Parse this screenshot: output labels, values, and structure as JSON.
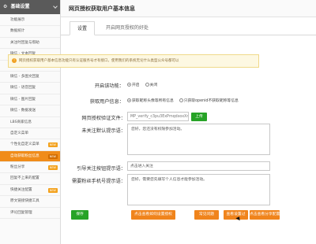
{
  "sidebar": {
    "header": "基础设置",
    "items": [
      {
        "label": "功能展示",
        "badge": ""
      },
      {
        "label": "数据统计",
        "badge": ""
      },
      {
        "label": "关注时回复与帮助",
        "badge": ""
      },
      {
        "label": "微信 - 文本回复",
        "badge": ""
      },
      {
        "label": "微信 - 图文回复",
        "badge": ""
      },
      {
        "label": "微信 - 多图文回复",
        "badge": ""
      },
      {
        "label": "微信 - 语音回复",
        "badge": ""
      },
      {
        "label": "微信 - 图片回复",
        "badge": ""
      },
      {
        "label": "微信 - 数据发送",
        "badge": ""
      },
      {
        "label": "LBS商家信息",
        "badge": ""
      },
      {
        "label": "自定义菜单",
        "badge": ""
      },
      {
        "label": "个性化自定义菜单",
        "badge": "NEW"
      },
      {
        "label": "自动获取粉丝信息",
        "badge": "NEW"
      },
      {
        "label": "粉丝分享",
        "badge": "NEW"
      },
      {
        "label": "回复不上来的配置",
        "badge": ""
      },
      {
        "label": "快捷关注配置",
        "badge": "NEW"
      },
      {
        "label": "原文链接快捷工具",
        "badge": ""
      },
      {
        "label": "评论回复管理",
        "badge": ""
      }
    ]
  },
  "page": {
    "title": "网页授权获取用户基本信息"
  },
  "tabs": [
    {
      "label": "设置"
    },
    {
      "label": "开启网页授权的好处"
    }
  ],
  "notice": "网页授权获取用户基本信息功能只有认证服务号才有接口，使用我们的系统无论什么类型公众号都可以",
  "form": {
    "enable_label": "开启该功能：",
    "enable_on": "开启",
    "enable_off": "关闭",
    "fetch_label": "获取用户信息：",
    "fetch_opt1": "获取昵称头像等所有信息",
    "fetch_opt2": "只获取openid不获取昵称等信息",
    "verify_label": "网页授权验证文件：",
    "verify_value": "MP_verify_c3pu3ExPmqdxoxXm",
    "upload_btn": "上传",
    "notfollow_label": "未关注默认提示语：",
    "notfollow_value": "您好，您还没有权限参加活动。",
    "guide_label": "引导关注按钮提示语：",
    "guide_value": "点击进入关注",
    "phone_label": "需要粉丝手机号提示语：",
    "phone_value": "您好，需要您先填写个人信息才能参加活动。"
  },
  "buttons": {
    "save": "保存",
    "view_auth": "点击查看如何设置授权",
    "faq": "常见问题",
    "view_demo": "查看设置过",
    "share": "点击查看分享配置"
  },
  "colors": {
    "active": "#f08c1a",
    "primary": "#27a327"
  }
}
